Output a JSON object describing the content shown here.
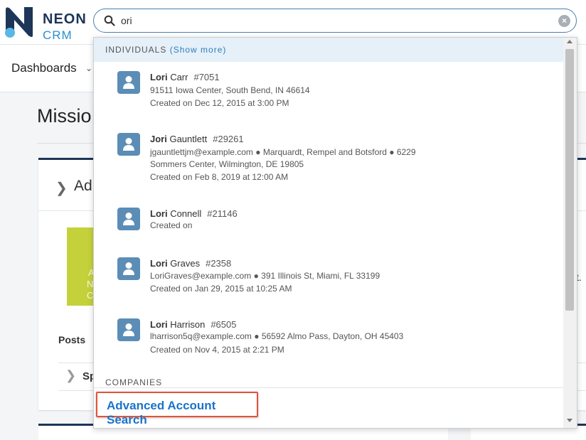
{
  "logo": {
    "word1": "NEON",
    "word2": "CRM"
  },
  "search": {
    "value": "ori"
  },
  "nav": {
    "dashboards": "Dashboards"
  },
  "page": {
    "title": "Missio",
    "card_title": "Ad",
    "posts_label": "Posts",
    "posts_row_text": "Sp",
    "promo_letters": [
      "A",
      "N",
      "C"
    ],
    "side_fragment": "t."
  },
  "dropdown": {
    "individuals_header": "INDIVIDUALS",
    "show_more": "(Show more)",
    "results": [
      {
        "first": "Lori",
        "last": "Carr",
        "id": "#7051",
        "lines": [
          "91511 Iowa Center, South Bend, IN 46614",
          "Created on Dec 12, 2015 at 3:00 PM"
        ]
      },
      {
        "first": "Jori",
        "last": "Gauntlett",
        "id": "#29261",
        "lines": [
          "jgauntlettjm@example.com ● Marquardt, Rempel and Botsford ● 6229",
          "Sommers Center, Wilmington, DE 19805",
          "Created on Feb 8, 2019 at 12:00 AM"
        ]
      },
      {
        "first": "Lori",
        "last": "Connell",
        "id": "#21146",
        "lines": [
          "Created on"
        ]
      },
      {
        "first": "Lori",
        "last": "Graves",
        "id": "#2358",
        "lines": [
          "LoriGraves@example.com ● 391 Illinois St, Miami, FL 33199",
          "Created on Jan 29, 2015 at 10:25 AM"
        ]
      },
      {
        "first": "Lori",
        "last": "Harrison",
        "id": "#6505",
        "lines": [
          "lharrison5q@example.com ● 56592 Almo Pass, Dayton, OH 45403",
          "Created on Nov 4, 2015 at 2:21 PM"
        ]
      }
    ],
    "companies_header": "COMPANIES",
    "advanced_search": "Advanced Account Search"
  },
  "colors": {
    "brand_navy": "#1d3557",
    "brand_blue": "#2a8fd0",
    "link": "#1a73c9",
    "highlight": "#e0543a",
    "avatar": "#5b8db6"
  }
}
